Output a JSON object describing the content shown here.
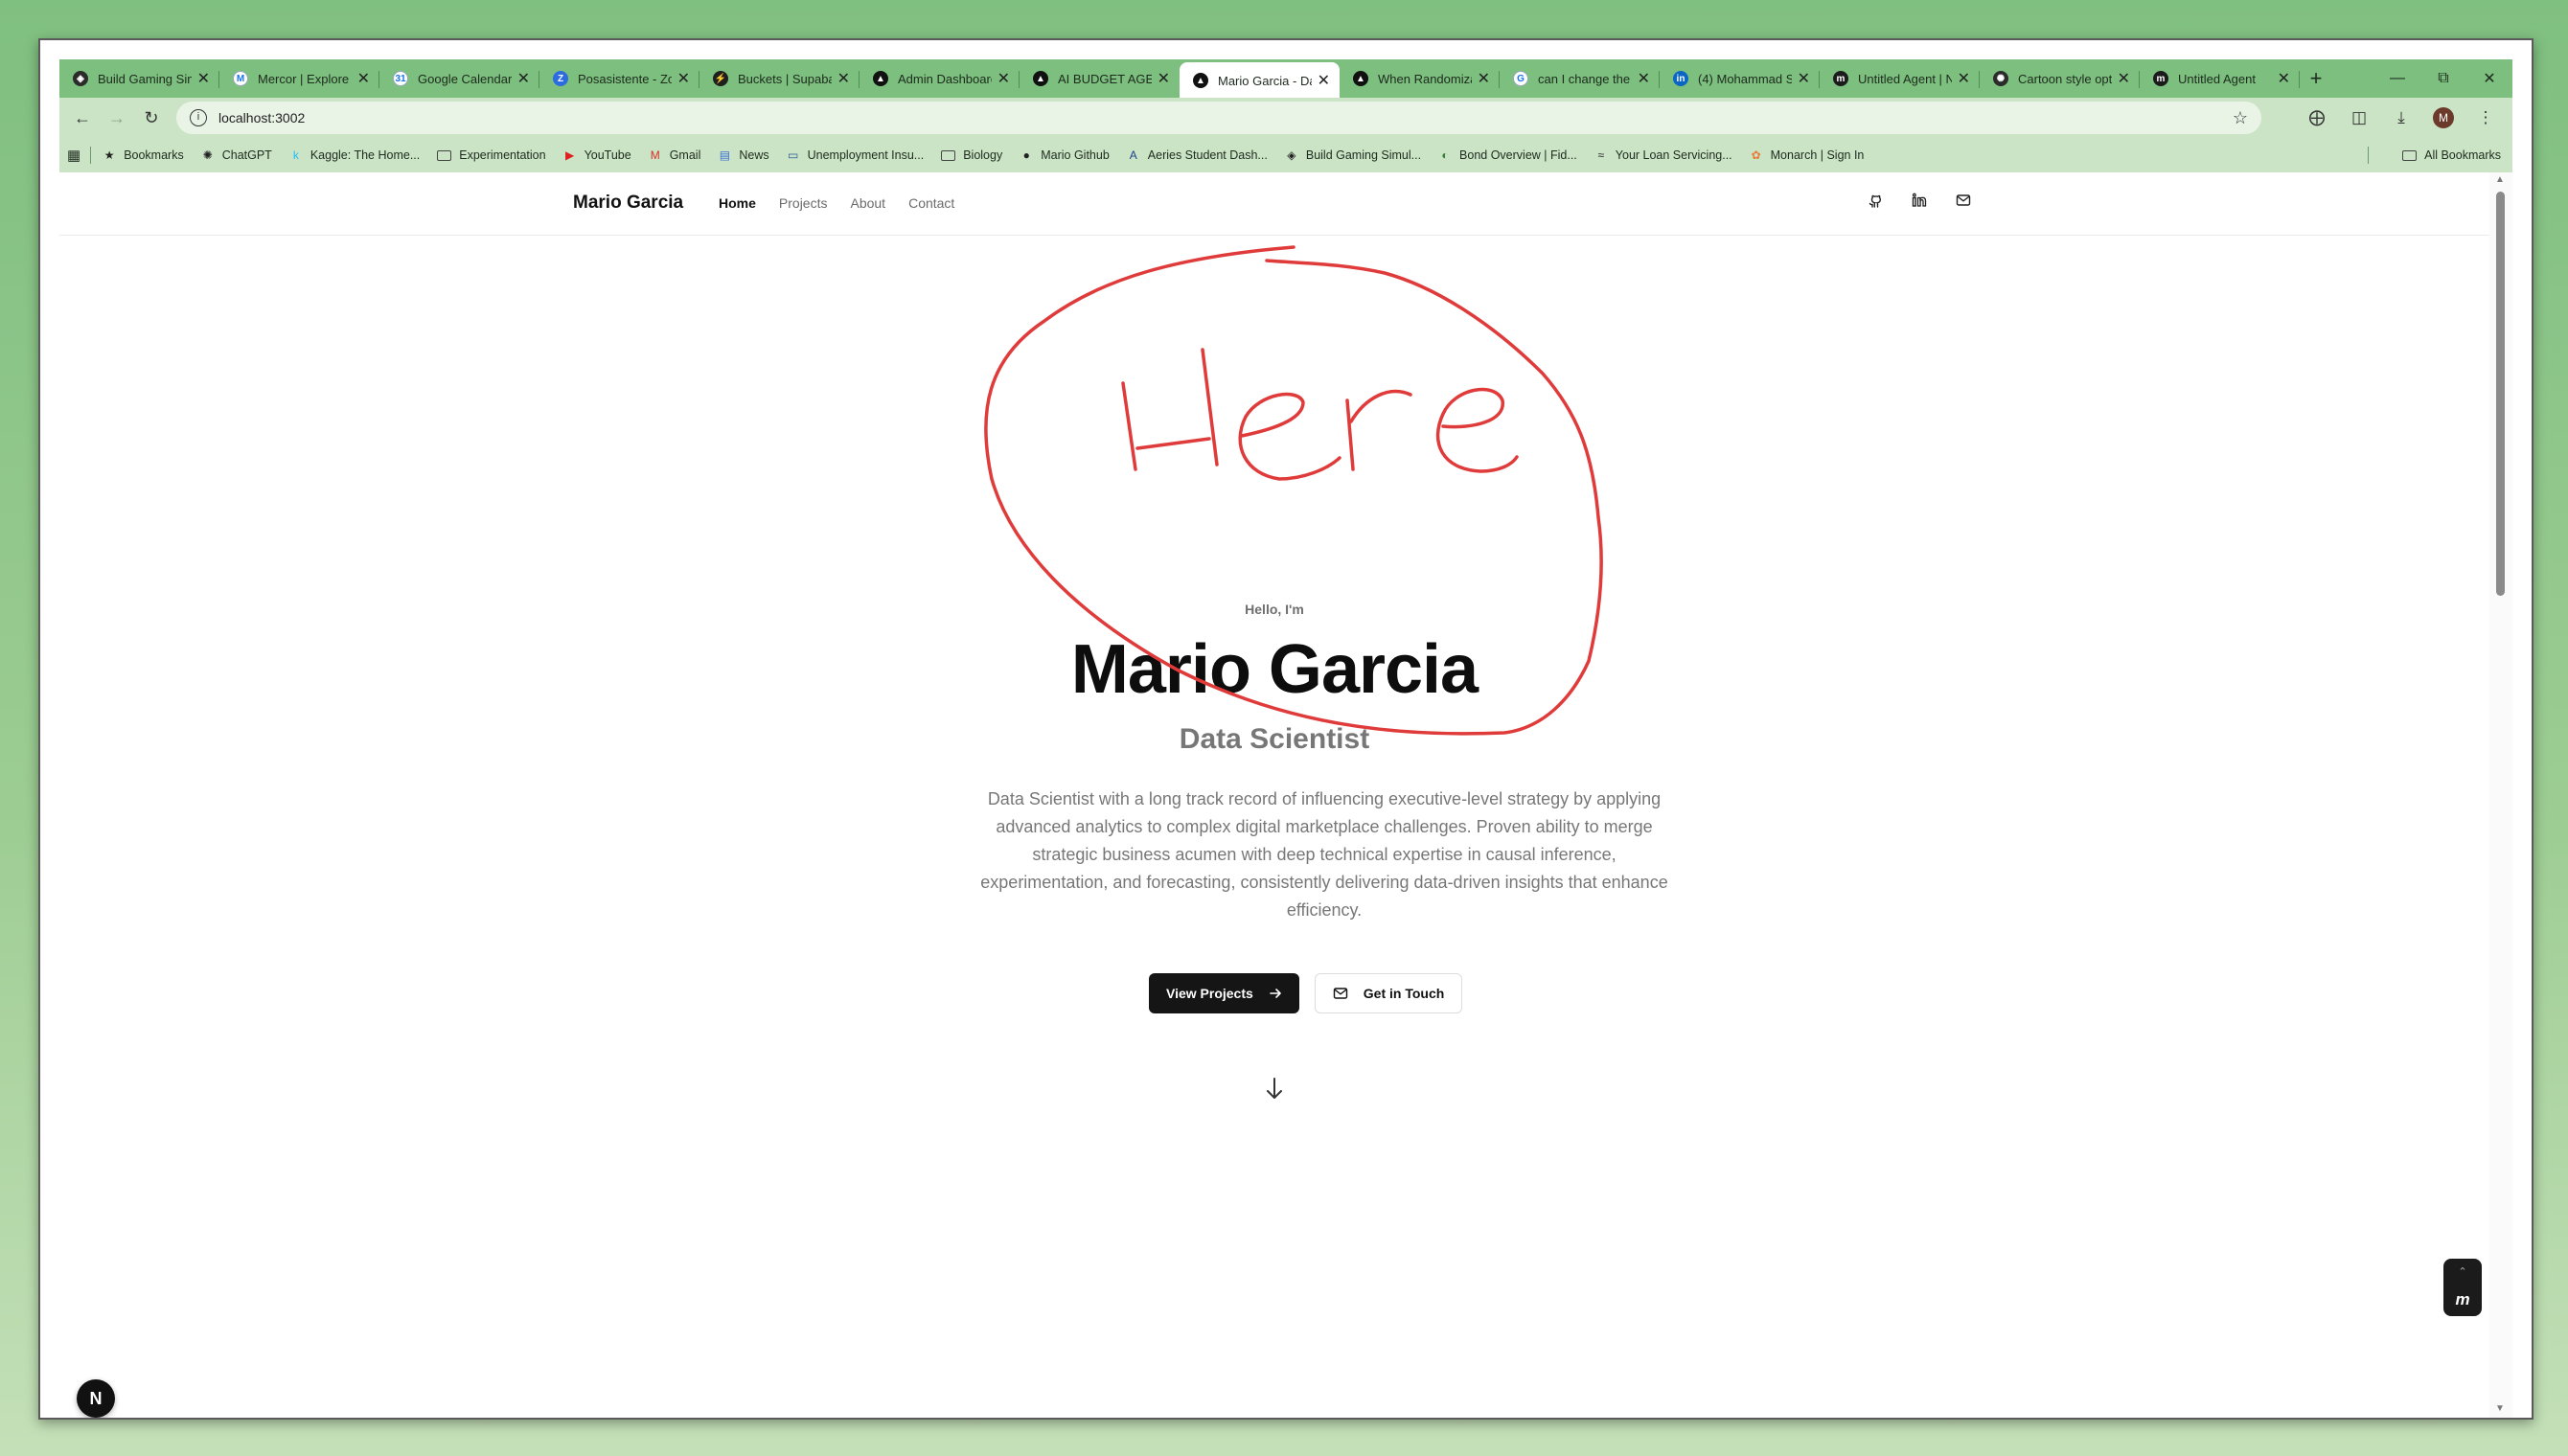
{
  "browser": {
    "tabs": [
      {
        "title": "Build Gaming Sim",
        "icon": "shield-icon"
      },
      {
        "title": "Mercor | Explore",
        "icon": "mercor-icon"
      },
      {
        "title": "Google Calendar",
        "icon": "calendar-icon"
      },
      {
        "title": "Posasistente - Zo",
        "icon": "zoom-icon"
      },
      {
        "title": "Buckets | Supabas",
        "icon": "supabase-icon"
      },
      {
        "title": "Admin Dashboard",
        "icon": "vercel-icon"
      },
      {
        "title": "AI BUDGET AGEN",
        "icon": "vercel-icon"
      },
      {
        "title": "Mario Garcia - Da",
        "icon": "vercel-icon",
        "active": true
      },
      {
        "title": "When Randomiza",
        "icon": "vercel-icon"
      },
      {
        "title": "can I change the",
        "icon": "google-icon"
      },
      {
        "title": "(4) Mohammad S",
        "icon": "linkedin-icon"
      },
      {
        "title": "Untitled Agent | N",
        "icon": "agent-icon"
      },
      {
        "title": "Cartoon style opti",
        "icon": "chatgpt-icon"
      },
      {
        "title": "Untitled Agent",
        "icon": "agent-icon"
      }
    ],
    "tab_close": "✕",
    "new_tab": "+",
    "url": "localhost:3002",
    "profile_initial": "M",
    "bookmarks": [
      {
        "label": "Bookmarks",
        "icon": "star-icon"
      },
      {
        "label": "ChatGPT",
        "icon": "chatgpt-icon"
      },
      {
        "label": "Kaggle: The Home...",
        "icon": "kaggle-icon"
      },
      {
        "label": "Experimentation",
        "icon": "folder-icon"
      },
      {
        "label": "YouTube",
        "icon": "youtube-icon"
      },
      {
        "label": "Gmail",
        "icon": "gmail-icon"
      },
      {
        "label": "News",
        "icon": "news-icon"
      },
      {
        "label": "Unemployment Insu...",
        "icon": "edd-icon"
      },
      {
        "label": "Biology",
        "icon": "folder-icon"
      },
      {
        "label": "Mario Github",
        "icon": "github-icon"
      },
      {
        "label": "Aeries Student Dash...",
        "icon": "aeries-icon"
      },
      {
        "label": "Build Gaming Simul...",
        "icon": "shield-icon"
      },
      {
        "label": "Bond Overview | Fid...",
        "icon": "fidelity-icon"
      },
      {
        "label": "Your Loan Servicing...",
        "icon": "loan-icon"
      },
      {
        "label": "Monarch | Sign In",
        "icon": "monarch-icon"
      }
    ],
    "all_bookmarks": "All Bookmarks"
  },
  "site": {
    "brand": "Mario Garcia",
    "nav": [
      "Home",
      "Projects",
      "About",
      "Contact"
    ],
    "active_nav": "Home",
    "social_icons": [
      "github-icon",
      "linkedin-icon",
      "mail-icon"
    ],
    "hero": {
      "greeting": "Hello, I'm",
      "name": "Mario Garcia",
      "role": "Data Scientist",
      "bio": "Data Scientist with a long track record of influencing executive-level strategy by applying advanced analytics to complex digital marketplace challenges. Proven ability to merge strategic business acumen with deep technical expertise in causal inference, experimentation, and forecasting, consistently delivering data-driven insights that enhance efficiency.",
      "primary_button": "View Projects",
      "secondary_button": "Get in Touch"
    },
    "next_badge": "N"
  },
  "annotation": {
    "text": "Here",
    "color": "#e03b3b"
  }
}
